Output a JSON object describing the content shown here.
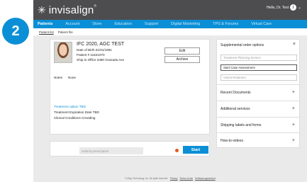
{
  "step_number": "2",
  "brand": {
    "name": "invisalign",
    "trademark": "®",
    "star": "✳"
  },
  "user": {
    "greeting": "Hello, Dr. Test",
    "icon_letter": "i"
  },
  "nav": {
    "items": [
      "Patients",
      "Account",
      "Store",
      "Education",
      "Support",
      "Digital Marketing",
      "TPS & Forums",
      "Virtual Care"
    ],
    "active_index": 0
  },
  "breadcrumb": {
    "items": [
      "Patient list",
      "Patient file"
    ]
  },
  "patient": {
    "name": "IFC 2020, AGC TEST",
    "dob": "Date of Birth  01/01/1991",
    "patient_number": "Patient #  11521070",
    "ship_to": "Ship to Office  3480 Granada Ave",
    "edit_label": "Edit",
    "archive_label": "Archive",
    "notes_label": "Notes",
    "notes_value": "None",
    "treatment_option": "Treatment option  TBD",
    "treatment_expiration": "Treatment Expiration Date  TBD",
    "clinical_conditions": "Clinical Conditions  Crowding"
  },
  "prescription": {
    "placeholder": "Submit prescription",
    "start_label": "Start"
  },
  "sidebar": {
    "title": "Supplemental order options",
    "close": "×",
    "options": [
      "Treatment Planning Service",
      "Start Case Assessment",
      "Vivera Retainers"
    ],
    "selected_index": 1,
    "sections": [
      "Recent Documents",
      "Additional services",
      "Shipping labels and forms",
      "How-to-videos"
    ],
    "plus": "+"
  },
  "footer": {
    "text": "© Align Technology, Inc. All rights reserved.",
    "links": [
      "Privacy",
      "Terms of Use",
      "Software agreement"
    ]
  },
  "colors": {
    "primary_blue": "#0a8fd6",
    "topbar": "#4d4d4f",
    "alert": "#e25c1f"
  }
}
